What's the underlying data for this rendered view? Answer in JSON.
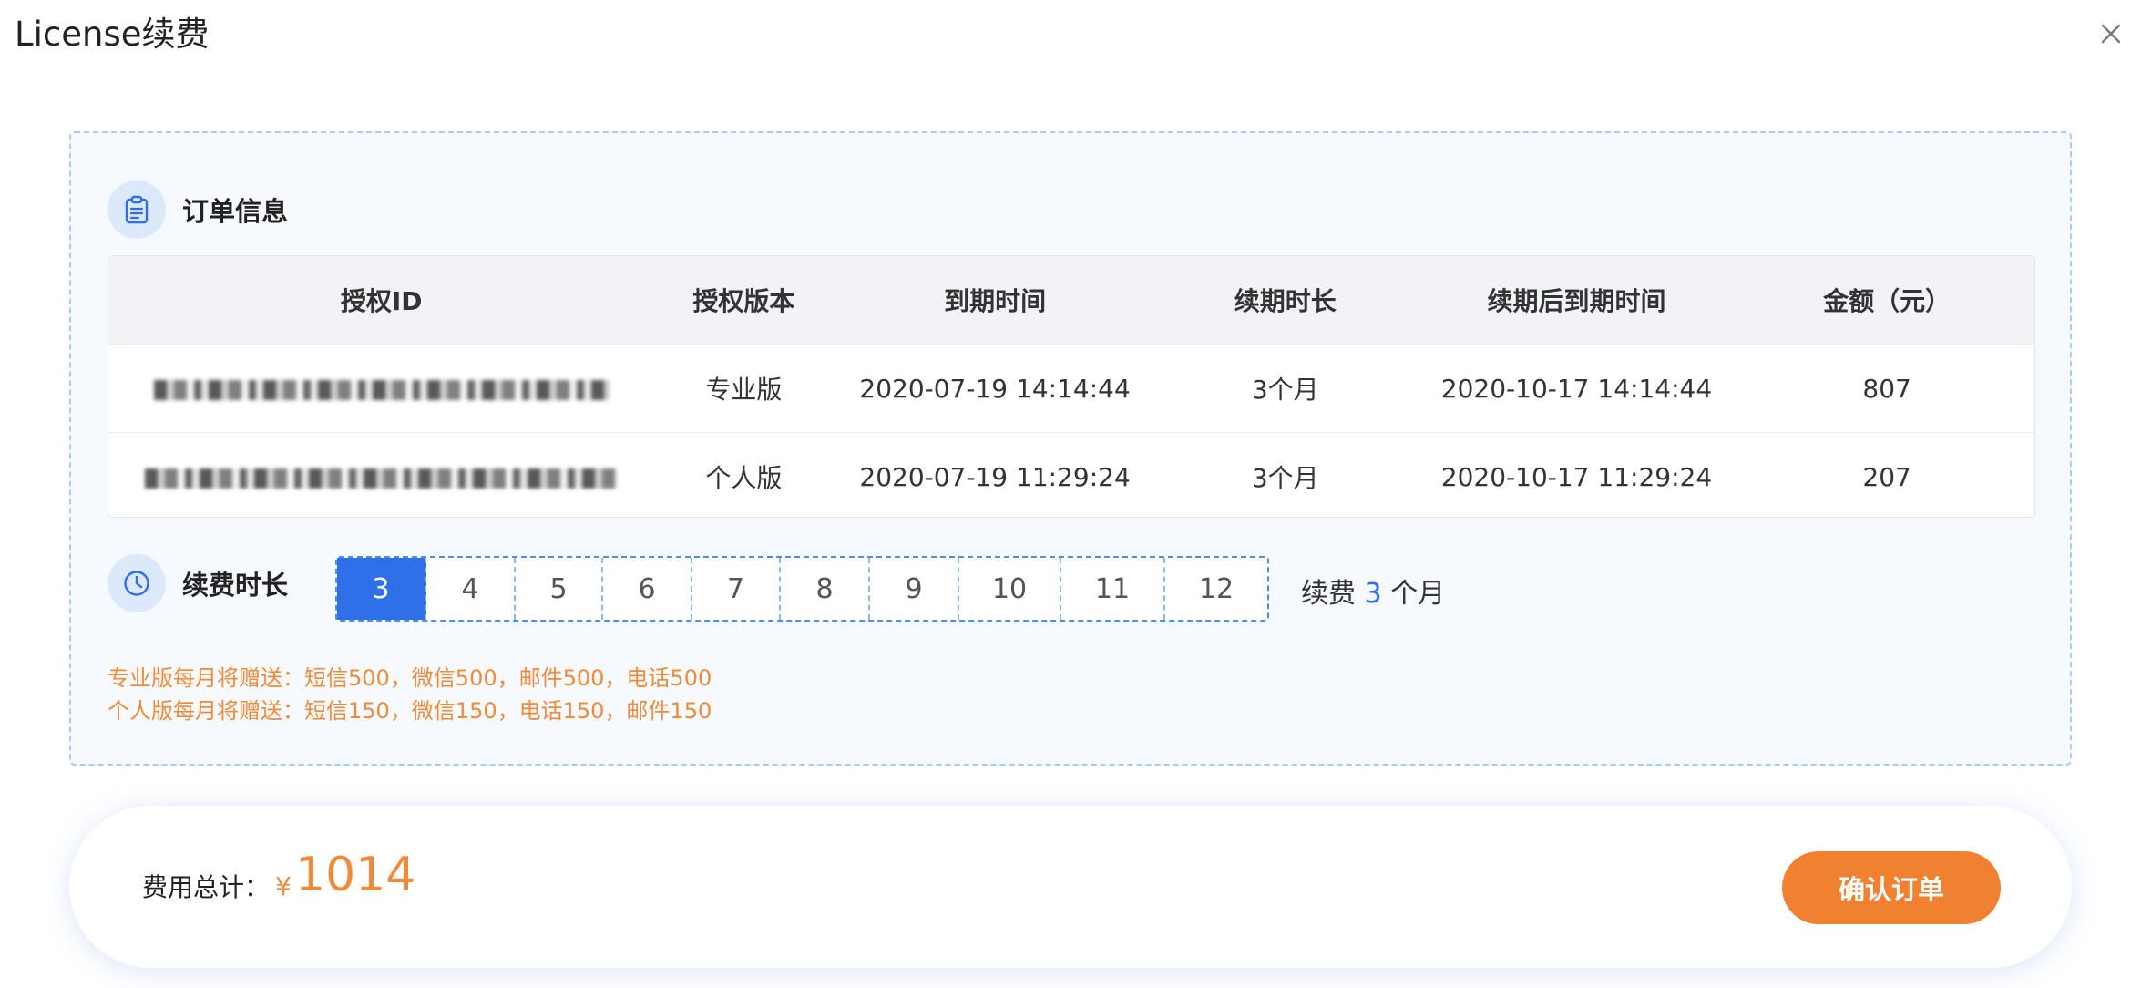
{
  "dialog": {
    "title": "License续费"
  },
  "order": {
    "heading": "订单信息",
    "columns": [
      "授权ID",
      "授权版本",
      "到期时间",
      "续期时长",
      "续期后到期时间",
      "金额（元）"
    ],
    "rows": [
      {
        "edition": "专业版",
        "expire": "2020-07-19 14:14:44",
        "duration": "3个月",
        "new_expire": "2020-10-17 14:14:44",
        "amount": "807"
      },
      {
        "edition": "个人版",
        "expire": "2020-07-19 11:29:24",
        "duration": "3个月",
        "new_expire": "2020-10-17 11:29:24",
        "amount": "207"
      }
    ]
  },
  "renewal": {
    "heading": "续费时长",
    "options": [
      "3",
      "4",
      "5",
      "6",
      "7",
      "8",
      "9",
      "10",
      "11",
      "12"
    ],
    "selected": "3",
    "summary_prefix": "续费",
    "summary_value": "3",
    "summary_suffix": "个月"
  },
  "promo": {
    "line1": "专业版每月将赠送：短信500，微信500，邮件500，电话500",
    "line2": "个人版每月将赠送：短信150，微信150，电话150，邮件150"
  },
  "footer": {
    "total_label": "费用总计：",
    "currency": "¥",
    "total_value": "1014",
    "confirm_label": "确认订单"
  },
  "colors": {
    "accent_blue": "#2f6fe8",
    "accent_orange": "#ef8130"
  },
  "icons": {
    "close": "close-icon",
    "order": "clipboard-icon",
    "duration": "clock-icon"
  }
}
